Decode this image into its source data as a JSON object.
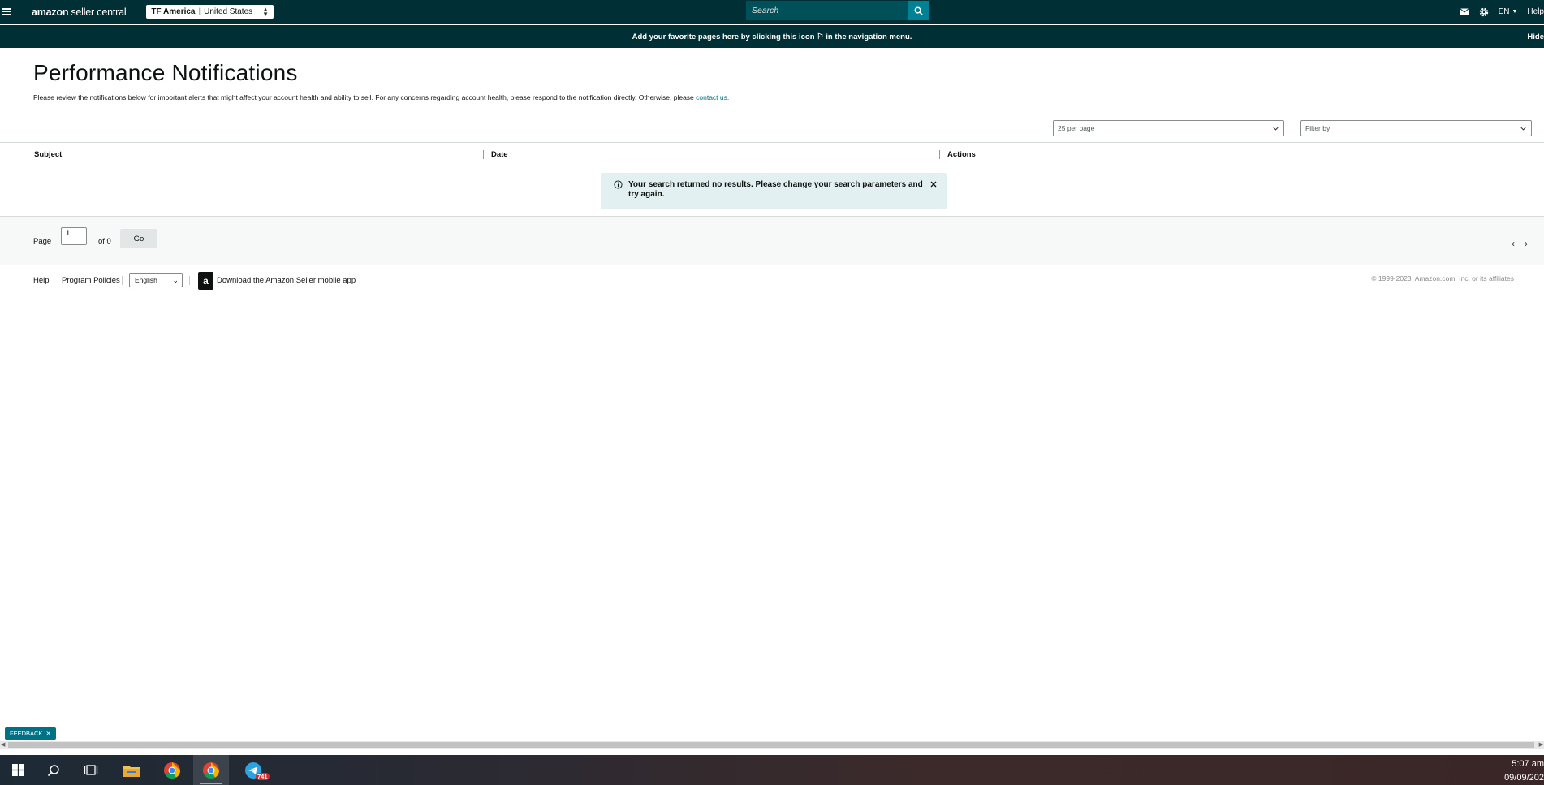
{
  "topbar": {
    "logo_brand": "amazon",
    "logo_rest": "seller central",
    "account_name": "TF America",
    "account_separator": "|",
    "account_region": "United States",
    "search_placeholder": "Search",
    "language": "EN",
    "help": "Help"
  },
  "favbar": {
    "message": "Add your favorite pages here by clicking this icon ⚐ in the navigation menu.",
    "hide": "Hide"
  },
  "page": {
    "title": "Performance Notifications",
    "intro": "Please review the notifications below for important alerts that might affect your account health and ability to sell. For any concerns regarding account health, please respond to the notification directly. Otherwise, please ",
    "intro_link": "contact us.",
    "per_page": "25 per page",
    "filter_placeholder": "Filter by"
  },
  "table": {
    "columns": [
      "Subject",
      "Date",
      "Actions"
    ]
  },
  "alert": {
    "message": "Your search returned no results. Please change your search parameters and try again."
  },
  "pager": {
    "page_label": "Page",
    "page_value": "1",
    "of_label": "of 0",
    "go": "Go"
  },
  "footer": {
    "help": "Help",
    "program_policies": "Program Policies",
    "language": "English",
    "app_link": "Download the Amazon Seller mobile app",
    "app_icon_letter": "a",
    "copyright": "© 1999-2023, Amazon.com, Inc. or its affiliates"
  },
  "feedback": {
    "label": "FEEDBACK",
    "close": "✕"
  },
  "taskbar": {
    "telegram_badge": "741",
    "time": "5:07 am",
    "date": "09/09/202"
  },
  "colors": {
    "nav_bg": "#002f36",
    "accent": "#008296",
    "link": "#007185",
    "alert_bg": "#e3f0f1"
  }
}
